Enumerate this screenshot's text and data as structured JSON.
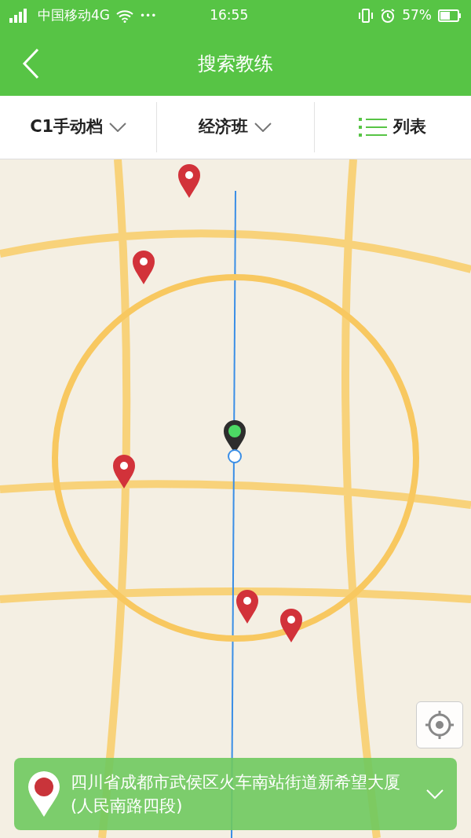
{
  "status_bar": {
    "carrier": "中国移动4G",
    "dots": "•••",
    "time": "16:55",
    "battery": "57%"
  },
  "header": {
    "title": "搜索教练"
  },
  "filters": [
    {
      "kind": "dropdown",
      "label": "C1手动档"
    },
    {
      "kind": "dropdown",
      "label": "经济班"
    },
    {
      "kind": "list",
      "label": "列表"
    }
  ],
  "location_card": {
    "address": "四川省成都市武侯区火车南站街道新希望大厦(人民南路四段)"
  }
}
